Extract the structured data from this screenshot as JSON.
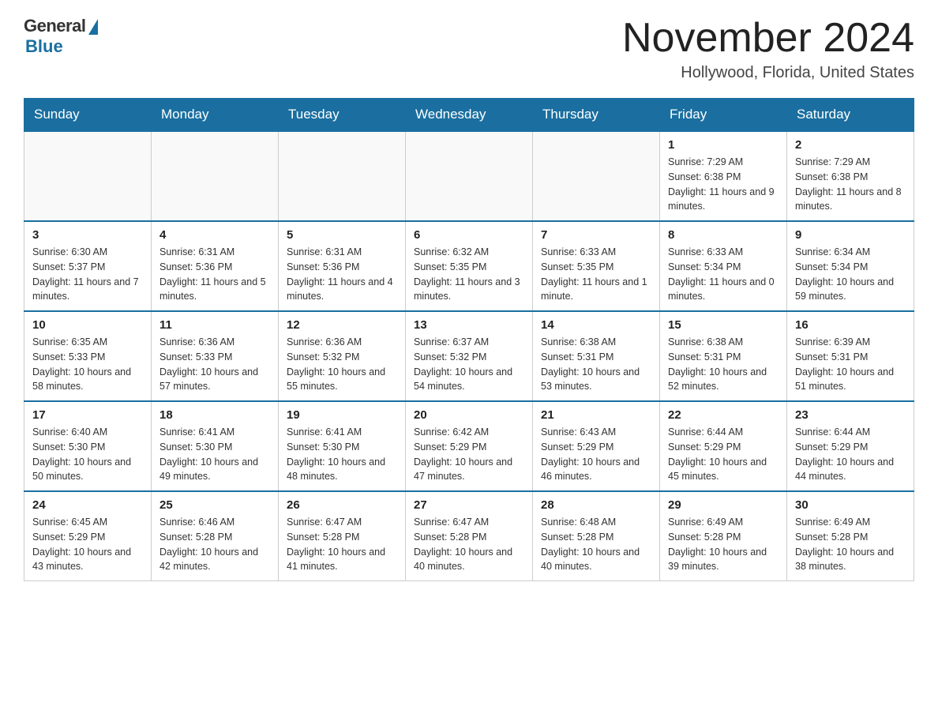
{
  "header": {
    "logo_general": "General",
    "logo_blue": "Blue",
    "month_title": "November 2024",
    "location": "Hollywood, Florida, United States"
  },
  "days_of_week": [
    "Sunday",
    "Monday",
    "Tuesday",
    "Wednesday",
    "Thursday",
    "Friday",
    "Saturday"
  ],
  "weeks": [
    [
      {
        "day": "",
        "info": ""
      },
      {
        "day": "",
        "info": ""
      },
      {
        "day": "",
        "info": ""
      },
      {
        "day": "",
        "info": ""
      },
      {
        "day": "",
        "info": ""
      },
      {
        "day": "1",
        "info": "Sunrise: 7:29 AM\nSunset: 6:38 PM\nDaylight: 11 hours and 9 minutes."
      },
      {
        "day": "2",
        "info": "Sunrise: 7:29 AM\nSunset: 6:38 PM\nDaylight: 11 hours and 8 minutes."
      }
    ],
    [
      {
        "day": "3",
        "info": "Sunrise: 6:30 AM\nSunset: 5:37 PM\nDaylight: 11 hours and 7 minutes."
      },
      {
        "day": "4",
        "info": "Sunrise: 6:31 AM\nSunset: 5:36 PM\nDaylight: 11 hours and 5 minutes."
      },
      {
        "day": "5",
        "info": "Sunrise: 6:31 AM\nSunset: 5:36 PM\nDaylight: 11 hours and 4 minutes."
      },
      {
        "day": "6",
        "info": "Sunrise: 6:32 AM\nSunset: 5:35 PM\nDaylight: 11 hours and 3 minutes."
      },
      {
        "day": "7",
        "info": "Sunrise: 6:33 AM\nSunset: 5:35 PM\nDaylight: 11 hours and 1 minute."
      },
      {
        "day": "8",
        "info": "Sunrise: 6:33 AM\nSunset: 5:34 PM\nDaylight: 11 hours and 0 minutes."
      },
      {
        "day": "9",
        "info": "Sunrise: 6:34 AM\nSunset: 5:34 PM\nDaylight: 10 hours and 59 minutes."
      }
    ],
    [
      {
        "day": "10",
        "info": "Sunrise: 6:35 AM\nSunset: 5:33 PM\nDaylight: 10 hours and 58 minutes."
      },
      {
        "day": "11",
        "info": "Sunrise: 6:36 AM\nSunset: 5:33 PM\nDaylight: 10 hours and 57 minutes."
      },
      {
        "day": "12",
        "info": "Sunrise: 6:36 AM\nSunset: 5:32 PM\nDaylight: 10 hours and 55 minutes."
      },
      {
        "day": "13",
        "info": "Sunrise: 6:37 AM\nSunset: 5:32 PM\nDaylight: 10 hours and 54 minutes."
      },
      {
        "day": "14",
        "info": "Sunrise: 6:38 AM\nSunset: 5:31 PM\nDaylight: 10 hours and 53 minutes."
      },
      {
        "day": "15",
        "info": "Sunrise: 6:38 AM\nSunset: 5:31 PM\nDaylight: 10 hours and 52 minutes."
      },
      {
        "day": "16",
        "info": "Sunrise: 6:39 AM\nSunset: 5:31 PM\nDaylight: 10 hours and 51 minutes."
      }
    ],
    [
      {
        "day": "17",
        "info": "Sunrise: 6:40 AM\nSunset: 5:30 PM\nDaylight: 10 hours and 50 minutes."
      },
      {
        "day": "18",
        "info": "Sunrise: 6:41 AM\nSunset: 5:30 PM\nDaylight: 10 hours and 49 minutes."
      },
      {
        "day": "19",
        "info": "Sunrise: 6:41 AM\nSunset: 5:30 PM\nDaylight: 10 hours and 48 minutes."
      },
      {
        "day": "20",
        "info": "Sunrise: 6:42 AM\nSunset: 5:29 PM\nDaylight: 10 hours and 47 minutes."
      },
      {
        "day": "21",
        "info": "Sunrise: 6:43 AM\nSunset: 5:29 PM\nDaylight: 10 hours and 46 minutes."
      },
      {
        "day": "22",
        "info": "Sunrise: 6:44 AM\nSunset: 5:29 PM\nDaylight: 10 hours and 45 minutes."
      },
      {
        "day": "23",
        "info": "Sunrise: 6:44 AM\nSunset: 5:29 PM\nDaylight: 10 hours and 44 minutes."
      }
    ],
    [
      {
        "day": "24",
        "info": "Sunrise: 6:45 AM\nSunset: 5:29 PM\nDaylight: 10 hours and 43 minutes."
      },
      {
        "day": "25",
        "info": "Sunrise: 6:46 AM\nSunset: 5:28 PM\nDaylight: 10 hours and 42 minutes."
      },
      {
        "day": "26",
        "info": "Sunrise: 6:47 AM\nSunset: 5:28 PM\nDaylight: 10 hours and 41 minutes."
      },
      {
        "day": "27",
        "info": "Sunrise: 6:47 AM\nSunset: 5:28 PM\nDaylight: 10 hours and 40 minutes."
      },
      {
        "day": "28",
        "info": "Sunrise: 6:48 AM\nSunset: 5:28 PM\nDaylight: 10 hours and 40 minutes."
      },
      {
        "day": "29",
        "info": "Sunrise: 6:49 AM\nSunset: 5:28 PM\nDaylight: 10 hours and 39 minutes."
      },
      {
        "day": "30",
        "info": "Sunrise: 6:49 AM\nSunset: 5:28 PM\nDaylight: 10 hours and 38 minutes."
      }
    ]
  ]
}
